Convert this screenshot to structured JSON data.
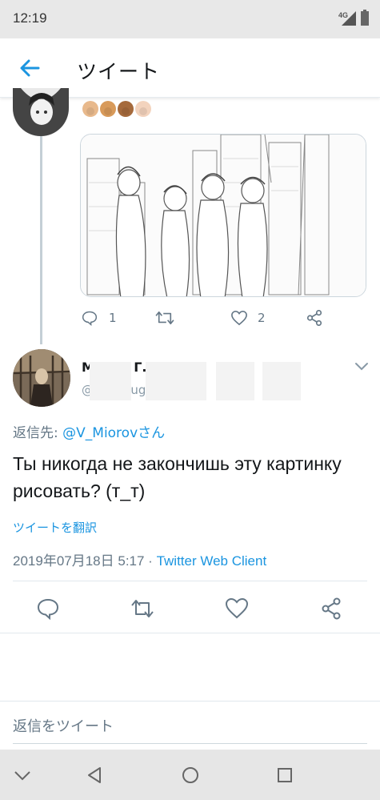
{
  "status_bar": {
    "time": "12:19",
    "network": "4G"
  },
  "header": {
    "title": "ツイート"
  },
  "parent_tweet": {
    "emojis": [
      "#e8b98c",
      "#d89a5a",
      "#a56a3c",
      "#f3d3bd"
    ],
    "actions": {
      "reply_count": "1",
      "like_count": "2"
    }
  },
  "main_tweet": {
    "name": "Мария Г.",
    "handle": "@mary_ug",
    "reply_to_prefix": "返信先: ",
    "reply_to_handle": "@V_Miorovさん",
    "text": "Ты никогда не закончишь эту картинку рисовать? (т_т)",
    "translate": "ツイートを翻訳",
    "timestamp": "2019年07月18日 5:17 · ",
    "client": "Twitter Web Client"
  },
  "reply_box": {
    "placeholder": "返信をツイート"
  },
  "colors": {
    "accent": "#1b95e0",
    "muted": "#657786"
  },
  "icons": [
    "back-arrow-icon",
    "caret-down-icon",
    "reply-icon",
    "retweet-icon",
    "like-icon",
    "share-icon",
    "nav-down-icon",
    "nav-back-icon",
    "nav-home-icon",
    "nav-recents-icon"
  ]
}
